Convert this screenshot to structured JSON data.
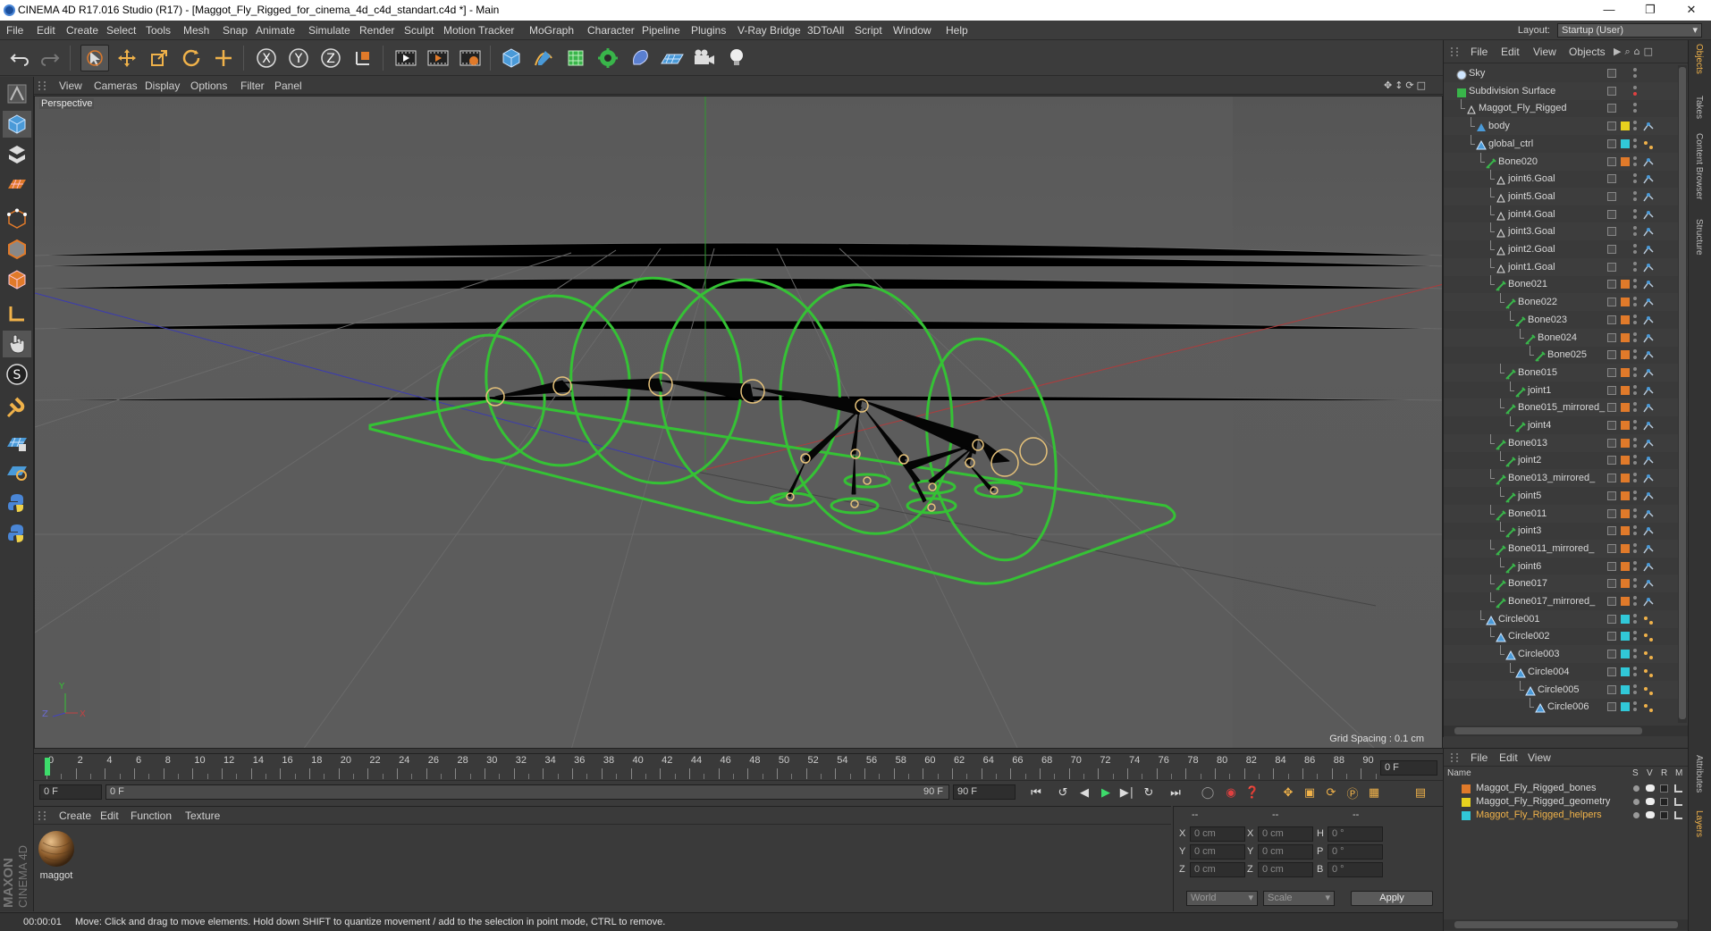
{
  "window": {
    "title": "CINEMA 4D R17.016 Studio (R17) - [Maggot_Fly_Rigged_for_cinema_4d_c4d_standart.c4d *] - Main"
  },
  "menubar": {
    "items": [
      "File",
      "Edit",
      "Create",
      "Select",
      "Tools",
      "Mesh",
      "Snap",
      "Animate",
      "Simulate",
      "Render",
      "Sculpt",
      "Motion Tracker",
      "MoGraph",
      "Character",
      "Pipeline",
      "Plugins",
      "V-Ray Bridge",
      "3DToAll",
      "Script",
      "Window",
      "Help"
    ],
    "layout_label": "Layout:",
    "layout_value": "Startup (User)"
  },
  "viewport": {
    "menu": [
      "View",
      "Cameras",
      "Display",
      "Options",
      "Filter",
      "Panel"
    ],
    "label": "Perspective",
    "grid_spacing": "Grid Spacing : 0.1 cm",
    "axis_x": "X",
    "axis_y": "Y",
    "axis_z": "Z"
  },
  "timeline": {
    "ticks": [
      "0",
      "2",
      "4",
      "6",
      "8",
      "10",
      "12",
      "14",
      "16",
      "18",
      "20",
      "22",
      "24",
      "26",
      "28",
      "30",
      "32",
      "34",
      "36",
      "38",
      "40",
      "42",
      "44",
      "46",
      "48",
      "50",
      "52",
      "54",
      "56",
      "58",
      "60",
      "62",
      "64",
      "66",
      "68",
      "70",
      "72",
      "74",
      "76",
      "78",
      "80",
      "82",
      "84",
      "86",
      "88",
      "90"
    ],
    "current_frame": "0 F"
  },
  "playbar": {
    "start_frame": "0 F",
    "range_start": "0 F",
    "range_end": "90 F",
    "end_frame": "90 F"
  },
  "materials": {
    "menu": [
      "Create",
      "Edit",
      "Function",
      "Texture"
    ],
    "items": [
      {
        "name": "maggot"
      }
    ]
  },
  "coordinates": {
    "headers": [
      "--",
      "--",
      "--"
    ],
    "rows": [
      {
        "a": "X",
        "a_val": "0 cm",
        "b": "X",
        "b_val": "0 cm",
        "c": "H",
        "c_val": "0 °"
      },
      {
        "a": "Y",
        "a_val": "0 cm",
        "b": "Y",
        "b_val": "0 cm",
        "c": "P",
        "c_val": "0 °"
      },
      {
        "a": "Z",
        "a_val": "0 cm",
        "b": "Z",
        "b_val": "0 cm",
        "c": "B",
        "c_val": "0 °"
      }
    ],
    "space_select": "World",
    "mode_select": "Scale",
    "apply": "Apply"
  },
  "status": {
    "time": "00:00:01",
    "message": "Move: Click and drag to move elements. Hold down SHIFT to quantize movement / add to the selection in point mode, CTRL to remove."
  },
  "objects": {
    "menu": [
      "File",
      "Edit",
      "View",
      "Objects"
    ],
    "tree": [
      {
        "name": "Sky",
        "depth": 0,
        "icon": "sky",
        "color": ""
      },
      {
        "name": "Subdivision Surface",
        "depth": 0,
        "icon": "subdiv",
        "color": ""
      },
      {
        "name": "Maggot_Fly_Rigged",
        "depth": 1,
        "icon": "null",
        "color": ""
      },
      {
        "name": "body",
        "depth": 2,
        "icon": "poly",
        "color": "#e8d21e"
      },
      {
        "name": "global_ctrl",
        "depth": 2,
        "icon": "spline",
        "color": "#31c8d8"
      },
      {
        "name": "Bone020",
        "depth": 3,
        "icon": "bone",
        "color": "#e07a2a"
      },
      {
        "name": "joint6.Goal",
        "depth": 4,
        "icon": "null",
        "color": ""
      },
      {
        "name": "joint5.Goal",
        "depth": 4,
        "icon": "null",
        "color": ""
      },
      {
        "name": "joint4.Goal",
        "depth": 4,
        "icon": "null",
        "color": ""
      },
      {
        "name": "joint3.Goal",
        "depth": 4,
        "icon": "null",
        "color": ""
      },
      {
        "name": "joint2.Goal",
        "depth": 4,
        "icon": "null",
        "color": ""
      },
      {
        "name": "joint1.Goal",
        "depth": 4,
        "icon": "null",
        "color": ""
      },
      {
        "name": "Bone021",
        "depth": 4,
        "icon": "bone",
        "color": "#e07a2a"
      },
      {
        "name": "Bone022",
        "depth": 5,
        "icon": "bone",
        "color": "#e07a2a"
      },
      {
        "name": "Bone023",
        "depth": 6,
        "icon": "bone",
        "color": "#e07a2a"
      },
      {
        "name": "Bone024",
        "depth": 7,
        "icon": "bone",
        "color": "#e07a2a"
      },
      {
        "name": "Bone025",
        "depth": 8,
        "icon": "bone",
        "color": "#e07a2a"
      },
      {
        "name": "Bone015",
        "depth": 5,
        "icon": "bone",
        "color": "#e07a2a"
      },
      {
        "name": "joint1",
        "depth": 6,
        "icon": "bone",
        "color": "#e07a2a"
      },
      {
        "name": "Bone015_mirrored_",
        "depth": 5,
        "icon": "bone",
        "color": "#e07a2a"
      },
      {
        "name": "joint4",
        "depth": 6,
        "icon": "bone",
        "color": "#e07a2a"
      },
      {
        "name": "Bone013",
        "depth": 4,
        "icon": "bone",
        "color": "#e07a2a"
      },
      {
        "name": "joint2",
        "depth": 5,
        "icon": "bone",
        "color": "#e07a2a"
      },
      {
        "name": "Bone013_mirrored_",
        "depth": 4,
        "icon": "bone",
        "color": "#e07a2a"
      },
      {
        "name": "joint5",
        "depth": 5,
        "icon": "bone",
        "color": "#e07a2a"
      },
      {
        "name": "Bone011",
        "depth": 4,
        "icon": "bone",
        "color": "#e07a2a"
      },
      {
        "name": "joint3",
        "depth": 5,
        "icon": "bone",
        "color": "#e07a2a"
      },
      {
        "name": "Bone011_mirrored_",
        "depth": 4,
        "icon": "bone",
        "color": "#e07a2a"
      },
      {
        "name": "joint6",
        "depth": 5,
        "icon": "bone",
        "color": "#e07a2a"
      },
      {
        "name": "Bone017",
        "depth": 4,
        "icon": "bone",
        "color": "#e07a2a"
      },
      {
        "name": "Bone017_mirrored_",
        "depth": 4,
        "icon": "bone",
        "color": "#e07a2a"
      },
      {
        "name": "Circle001",
        "depth": 3,
        "icon": "spline",
        "color": "#31c8d8"
      },
      {
        "name": "Circle002",
        "depth": 4,
        "icon": "spline",
        "color": "#31c8d8"
      },
      {
        "name": "Circle003",
        "depth": 5,
        "icon": "spline",
        "color": "#31c8d8"
      },
      {
        "name": "Circle004",
        "depth": 6,
        "icon": "spline",
        "color": "#31c8d8"
      },
      {
        "name": "Circle005",
        "depth": 7,
        "icon": "spline",
        "color": "#31c8d8"
      },
      {
        "name": "Circle006",
        "depth": 8,
        "icon": "spline",
        "color": "#31c8d8"
      }
    ]
  },
  "layers": {
    "menu": [
      "File",
      "Edit",
      "View"
    ],
    "headers": {
      "name": "Name",
      "s": "S",
      "v": "V",
      "r": "R",
      "m": "M"
    },
    "items": [
      {
        "name": "Maggot_Fly_Rigged_bones",
        "color": "#e07a2a",
        "text_color": "#d8d8d8"
      },
      {
        "name": "Maggot_Fly_Rigged_geometry",
        "color": "#e8d21e",
        "text_color": "#d8d8d8"
      },
      {
        "name": "Maggot_Fly_Rigged_helpers",
        "color": "#31c8d8",
        "text_color": "#f0b24a"
      }
    ]
  },
  "side_tabs": [
    "Objects",
    "Takes",
    "Content Browser",
    "Structure",
    "Attributes",
    "Layers"
  ],
  "brand": {
    "maker": "MAXON",
    "product": "CINEMA 4D"
  }
}
